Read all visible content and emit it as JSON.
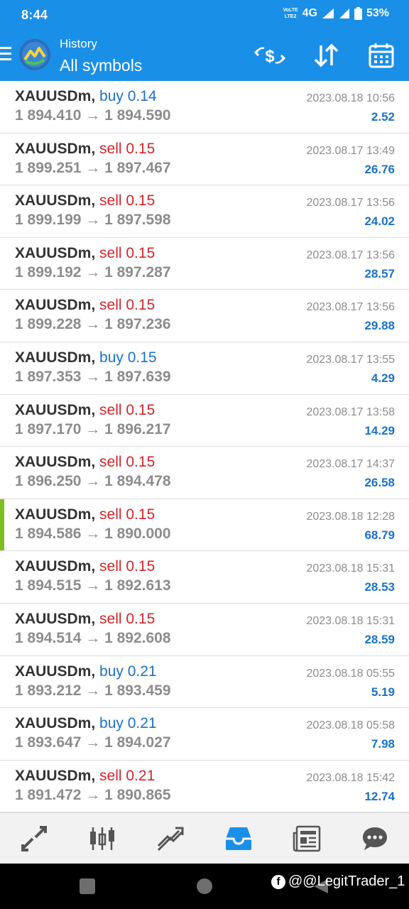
{
  "status_bar": {
    "time": "8:44",
    "volte_top": "VoLTE",
    "volte_bottom": "LTE2",
    "network": "4G",
    "battery": "53%"
  },
  "app_bar": {
    "title_small": "History",
    "title_big": "All symbols",
    "icons": [
      "menu-icon",
      "metatrader-logo",
      "currency-exchange-icon",
      "sort-icon",
      "calendar-icon"
    ]
  },
  "trades": [
    {
      "symbol": "XAUUSDm,",
      "side": "buy",
      "side_label": "buy 0.14",
      "prices": "1 894.410 → 1 894.590",
      "date": "2023.08.18 10:56",
      "profit": "2.52",
      "highlight": false
    },
    {
      "symbol": "XAUUSDm,",
      "side": "sell",
      "side_label": "sell 0.15",
      "prices": "1 899.251 → 1 897.467",
      "date": "2023.08.17 13:49",
      "profit": "26.76",
      "highlight": false
    },
    {
      "symbol": "XAUUSDm,",
      "side": "sell",
      "side_label": "sell 0.15",
      "prices": "1 899.199 → 1 897.598",
      "date": "2023.08.17 13:56",
      "profit": "24.02",
      "highlight": false
    },
    {
      "symbol": "XAUUSDm,",
      "side": "sell",
      "side_label": "sell 0.15",
      "prices": "1 899.192 → 1 897.287",
      "date": "2023.08.17 13:56",
      "profit": "28.57",
      "highlight": false
    },
    {
      "symbol": "XAUUSDm,",
      "side": "sell",
      "side_label": "sell 0.15",
      "prices": "1 899.228 → 1 897.236",
      "date": "2023.08.17 13:56",
      "profit": "29.88",
      "highlight": false
    },
    {
      "symbol": "XAUUSDm,",
      "side": "buy",
      "side_label": "buy 0.15",
      "prices": "1 897.353 → 1 897.639",
      "date": "2023.08.17 13:55",
      "profit": "4.29",
      "highlight": false
    },
    {
      "symbol": "XAUUSDm,",
      "side": "sell",
      "side_label": "sell 0.15",
      "prices": "1 897.170 → 1 896.217",
      "date": "2023.08.17 13:58",
      "profit": "14.29",
      "highlight": false
    },
    {
      "symbol": "XAUUSDm,",
      "side": "sell",
      "side_label": "sell 0.15",
      "prices": "1 896.250 → 1 894.478",
      "date": "2023.08.17 14:37",
      "profit": "26.58",
      "highlight": false
    },
    {
      "symbol": "XAUUSDm,",
      "side": "sell",
      "side_label": "sell 0.15",
      "prices": "1 894.586 → 1 890.000",
      "date": "2023.08.18 12:28",
      "profit": "68.79",
      "highlight": true
    },
    {
      "symbol": "XAUUSDm,",
      "side": "sell",
      "side_label": "sell 0.15",
      "prices": "1 894.515 → 1 892.613",
      "date": "2023.08.18 15:31",
      "profit": "28.53",
      "highlight": false
    },
    {
      "symbol": "XAUUSDm,",
      "side": "sell",
      "side_label": "sell 0.15",
      "prices": "1 894.514 → 1 892.608",
      "date": "2023.08.18 15:31",
      "profit": "28.59",
      "highlight": false
    },
    {
      "symbol": "XAUUSDm,",
      "side": "buy",
      "side_label": "buy 0.21",
      "prices": "1 893.212 → 1 893.459",
      "date": "2023.08.18 05:55",
      "profit": "5.19",
      "highlight": false
    },
    {
      "symbol": "XAUUSDm,",
      "side": "buy",
      "side_label": "buy 0.21",
      "prices": "1 893.647 → 1 894.027",
      "date": "2023.08.18 05:58",
      "profit": "7.98",
      "highlight": false
    },
    {
      "symbol": "XAUUSDm,",
      "side": "sell",
      "side_label": "sell 0.21",
      "prices": "1 891.472 → 1 890.865",
      "date": "2023.08.18 15:42",
      "profit": "12.74",
      "highlight": false
    }
  ],
  "tab_bar": {
    "tabs": [
      "quotes-icon",
      "chart-icon",
      "trade-icon",
      "history-icon",
      "news-icon",
      "chat-icon"
    ],
    "active": "history-icon",
    "active_color": "#1a8fe8",
    "inactive_color": "#555555"
  },
  "nav_bar": {
    "watermark": "@@LegitTrader_1",
    "watermark_badge": "f"
  },
  "colors": {
    "primary": "#1a8fe8",
    "buy": "#1a72c6",
    "sell": "#d0262b",
    "profit": "#1a72c6",
    "highlight_bar": "#7cbf1e"
  }
}
